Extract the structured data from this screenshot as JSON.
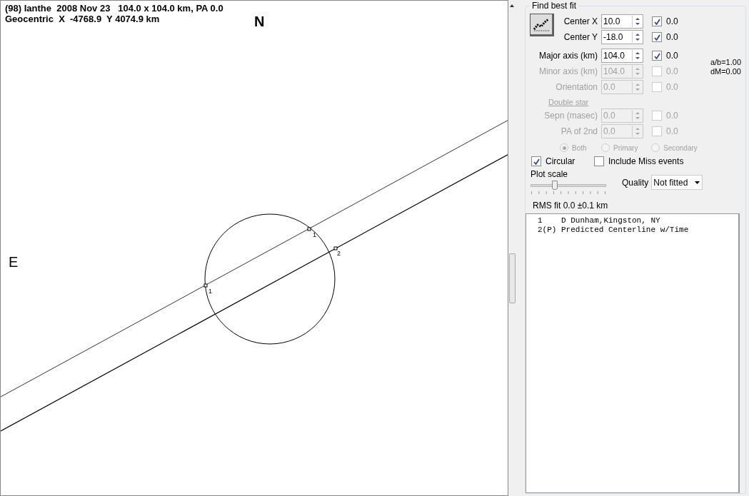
{
  "plot": {
    "header": [
      "(98) Ianthe  2008 Nov 23   104.0 x 104.0 km, PA 0.0",
      "Geocentric  X  -4768.9  Y 4074.9 km"
    ],
    "north_label": "N",
    "east_label": "E",
    "chords": [
      {
        "kind": "chord",
        "markers": [
          {
            "label": "1"
          },
          {
            "label": "1"
          }
        ]
      },
      {
        "kind": "centerline",
        "markers": [
          {
            "label": "2"
          }
        ]
      }
    ]
  },
  "fit_panel": {
    "title": "Find best fit",
    "rows": [
      {
        "label": "Center X",
        "value": "10.0",
        "checked": true,
        "result": "0.0",
        "disabled": false
      },
      {
        "label": "Center Y",
        "value": "-18.0",
        "checked": true,
        "result": "0.0",
        "disabled": false
      },
      {
        "label": "Major axis (km)",
        "value": "104.0",
        "checked": true,
        "result": "0.0",
        "disabled": false
      },
      {
        "label": "Minor axis (km)",
        "value": "104.0",
        "checked": false,
        "result": "0.0",
        "disabled": true
      },
      {
        "label": "Orientation",
        "value": "0.0",
        "checked": false,
        "result": "0.0",
        "disabled": true
      }
    ],
    "ratio": "a/b=1.00",
    "dm": "dM=0.00",
    "double_star": "Double star",
    "double_rows": [
      {
        "label": "Sepn (masec)",
        "value": "0.0",
        "checked": false,
        "result": "0.0",
        "disabled": true
      },
      {
        "label": "PA of 2nd",
        "value": "0.0",
        "checked": false,
        "result": "0.0",
        "disabled": true
      }
    ],
    "radios": [
      {
        "label": "Both",
        "selected": true
      },
      {
        "label": "Primary",
        "selected": false
      },
      {
        "label": "Secondary",
        "selected": false
      }
    ],
    "options": [
      {
        "label": "Circular",
        "checked": true
      },
      {
        "label": "Include Miss events",
        "checked": false
      }
    ],
    "plot_scale": {
      "label": "Plot scale",
      "level": 0.3
    },
    "quality": {
      "label": "Quality",
      "value": "Not fitted"
    },
    "rms": "RMS fit 0.0 ±0.1 km",
    "list": [
      "1    D Dunham,Kingston, NY",
      "2(P) Predicted Centerline w/Time"
    ]
  }
}
